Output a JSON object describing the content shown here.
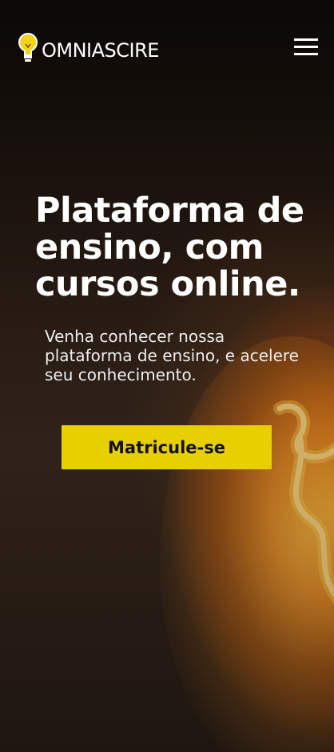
{
  "brand": {
    "name": "OMNIASCIRE",
    "icon": "lightbulb-icon",
    "icon_color": "#f2d21b"
  },
  "nav": {
    "menu_icon": "hamburger-menu-icon"
  },
  "hero": {
    "headline": "Plataforma de ensino, com cursos online.",
    "subtitle": "Venha conhecer nossa plataforma de ensino, e acelere seu conhecimento.",
    "cta_label": "Matricule-se",
    "cta_color": "#e8cf00"
  }
}
